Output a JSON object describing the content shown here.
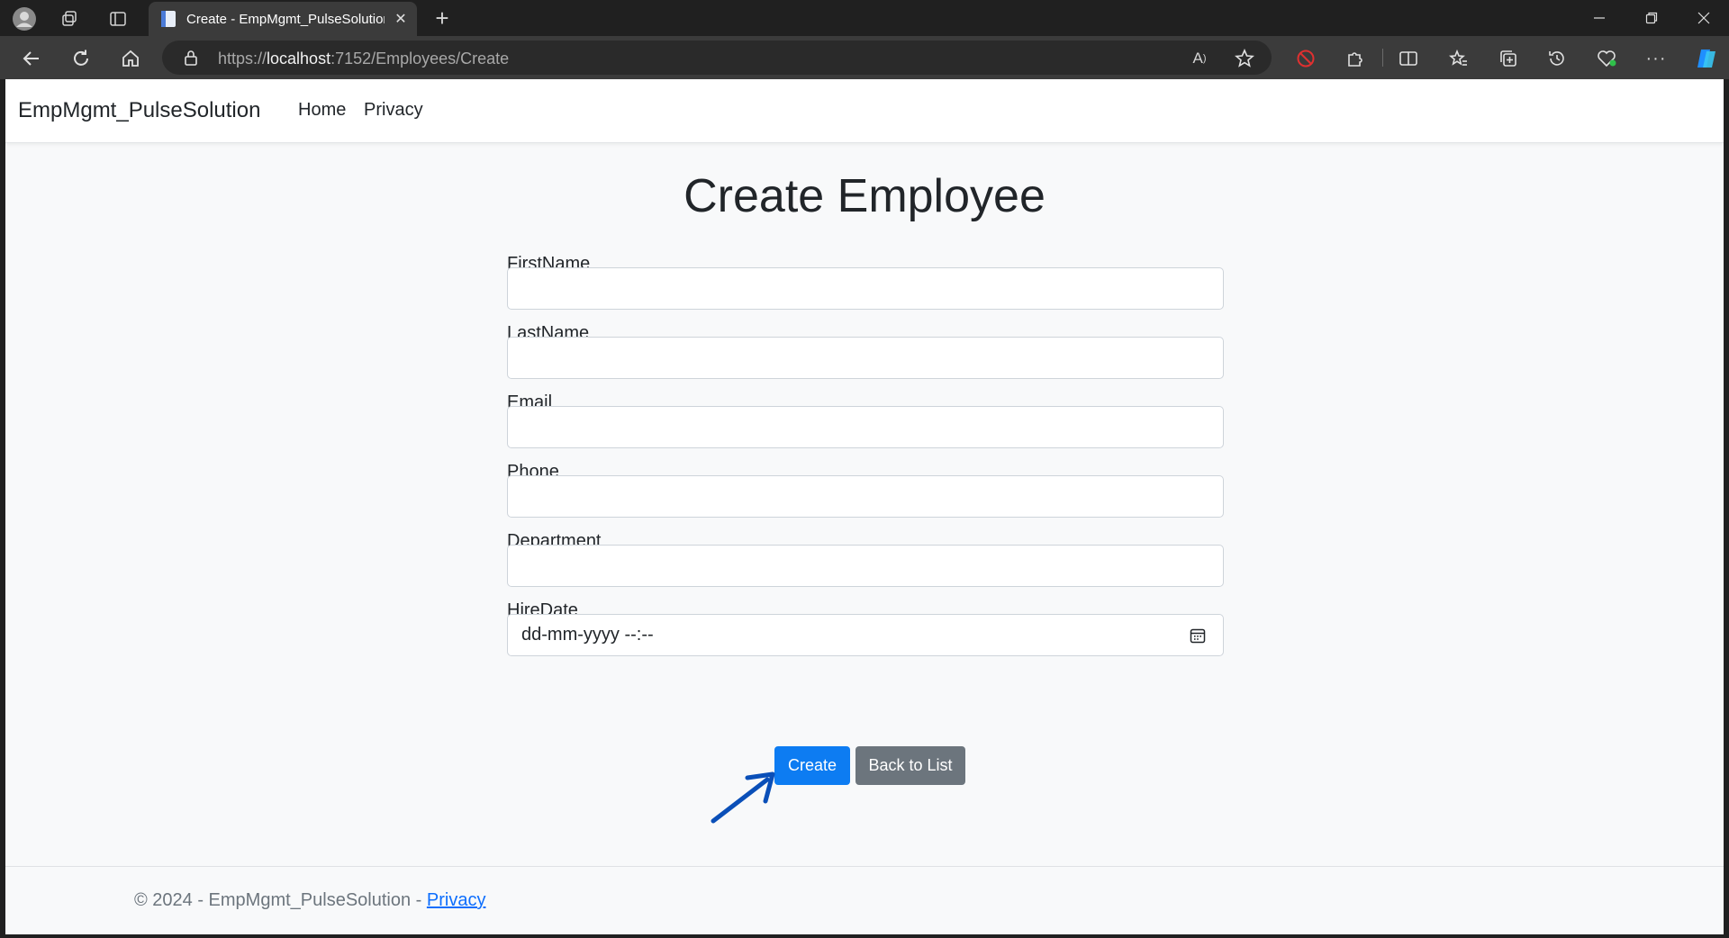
{
  "browser": {
    "tab_title": "Create - EmpMgmt_PulseSolution",
    "url_scheme": "https://",
    "url_host": "localhost",
    "url_path": ":7152/Employees/Create"
  },
  "navbar": {
    "brand": "EmpMgmt_PulseSolution",
    "links": [
      "Home",
      "Privacy"
    ]
  },
  "page": {
    "title": "Create Employee"
  },
  "form": {
    "fields": [
      {
        "label": "FirstName",
        "value": ""
      },
      {
        "label": "LastName",
        "value": ""
      },
      {
        "label": "Email",
        "value": ""
      },
      {
        "label": "Phone",
        "value": ""
      },
      {
        "label": "Department",
        "value": ""
      },
      {
        "label": "HireDate",
        "value": "dd-mm-yyyy --:--"
      }
    ],
    "create_label": "Create",
    "back_label": "Back to List"
  },
  "footer": {
    "text": "© 2024 - EmpMgmt_PulseSolution - ",
    "link": "Privacy"
  },
  "colors": {
    "primary": "#0d7cf2",
    "secondary": "#6c757d",
    "annotation_arrow": "#0a4fb8"
  }
}
